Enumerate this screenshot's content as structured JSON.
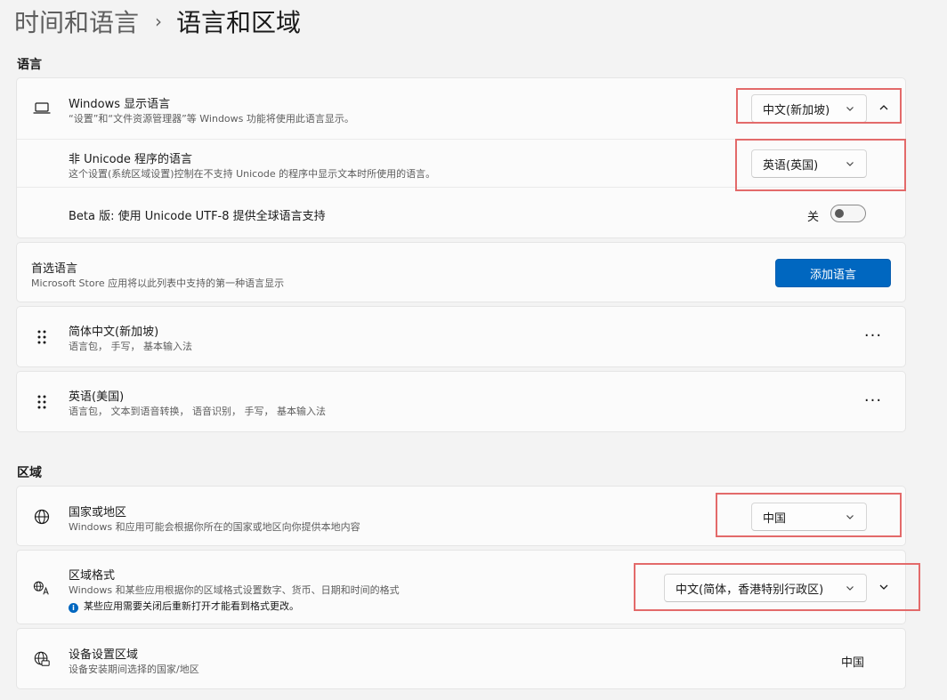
{
  "breadcrumb": {
    "parent": "时间和语言",
    "separator": "›",
    "current": "语言和区域"
  },
  "language_section": {
    "title": "语言",
    "display_language": {
      "title": "Windows 显示语言",
      "desc": "“设置”和“文件资源管理器”等 Windows 功能将使用此语言显示。",
      "value": "中文(新加坡)"
    },
    "non_unicode": {
      "title": "非 Unicode 程序的语言",
      "desc": "这个设置(系统区域设置)控制在不支持 Unicode 的程序中显示文本时所使用的语言。",
      "value": "英语(英国)"
    },
    "utf8_beta": {
      "title": "Beta 版: 使用 Unicode UTF-8 提供全球语言支持",
      "toggle_label": "关"
    },
    "preferred": {
      "title": "首选语言",
      "desc": "Microsoft Store 应用将以此列表中支持的第一种语言显示",
      "add_button": "添加语言"
    },
    "languages": [
      {
        "title": "简体中文(新加坡)",
        "desc": "语言包， 手写， 基本输入法",
        "more": "···"
      },
      {
        "title": "英语(美国)",
        "desc": "语言包， 文本到语音转换， 语音识别， 手写， 基本输入法",
        "more": "···"
      }
    ]
  },
  "region_section": {
    "title": "区域",
    "country": {
      "title": "国家或地区",
      "desc": "Windows 和应用可能会根据你所在的国家或地区向你提供本地内容",
      "value": "中国"
    },
    "format": {
      "title": "区域格式",
      "desc": "Windows 和某些应用根据你的区域格式设置数字、货币、日期和时间的格式",
      "info": "某些应用需要关闭后重新打开才能看到格式更改。",
      "info_icon": "i",
      "value": "中文(简体，香港特别行政区)"
    },
    "device_region": {
      "title": "设备设置区域",
      "desc": "设备安装期间选择的国家/地区",
      "value": "中国"
    }
  },
  "colors": {
    "accent": "#0067c0",
    "highlight": "#e36a6a"
  }
}
